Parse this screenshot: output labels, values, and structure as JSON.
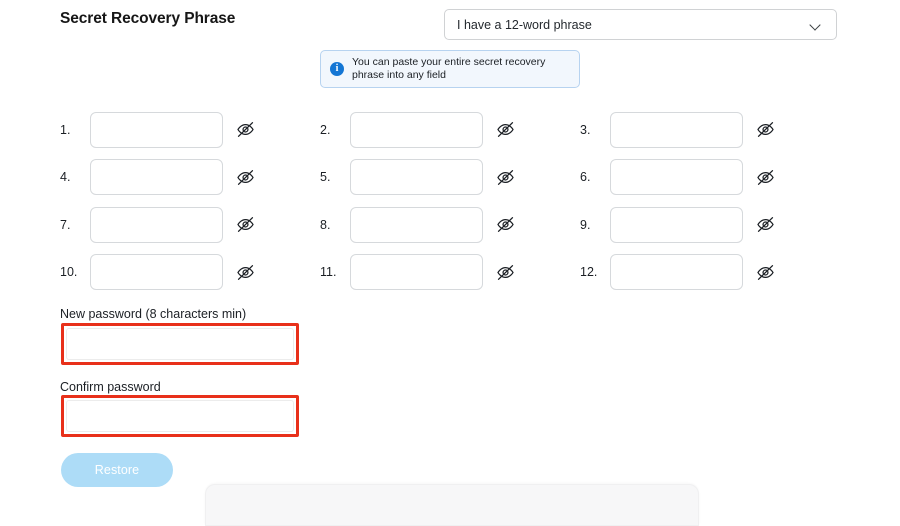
{
  "header": {
    "title": "Secret Recovery Phrase",
    "phrase_type_select": {
      "value": "I have a 12-word phrase",
      "chevron_icon": "chevron-down-icon"
    }
  },
  "info_banner": {
    "icon": "info-circle-icon",
    "icon_glyph": "i",
    "text": "You can paste your entire secret recovery phrase into any field",
    "accent_color": "#1476d4",
    "background_color": "#f2f7fd",
    "border_color": "#b7d3f0"
  },
  "word_fields": [
    {
      "number": "1.",
      "value": "",
      "toggle_icon": "eye-off-icon"
    },
    {
      "number": "2.",
      "value": "",
      "toggle_icon": "eye-off-icon"
    },
    {
      "number": "3.",
      "value": "",
      "toggle_icon": "eye-off-icon"
    },
    {
      "number": "4.",
      "value": "",
      "toggle_icon": "eye-off-icon"
    },
    {
      "number": "5.",
      "value": "",
      "toggle_icon": "eye-off-icon"
    },
    {
      "number": "6.",
      "value": "",
      "toggle_icon": "eye-off-icon"
    },
    {
      "number": "7.",
      "value": "",
      "toggle_icon": "eye-off-icon"
    },
    {
      "number": "8.",
      "value": "",
      "toggle_icon": "eye-off-icon"
    },
    {
      "number": "9.",
      "value": "",
      "toggle_icon": "eye-off-icon"
    },
    {
      "number": "10.",
      "value": "",
      "toggle_icon": "eye-off-icon"
    },
    {
      "number": "11.",
      "value": "",
      "toggle_icon": "eye-off-icon"
    },
    {
      "number": "12.",
      "value": "",
      "toggle_icon": "eye-off-icon"
    }
  ],
  "password": {
    "new_label": "New password (8 characters min)",
    "new_value": "",
    "confirm_label": "Confirm password",
    "confirm_value": "",
    "highlight_color": "#e8301a"
  },
  "actions": {
    "restore_label": "Restore",
    "restore_enabled": false,
    "restore_color": "#addcf7"
  }
}
